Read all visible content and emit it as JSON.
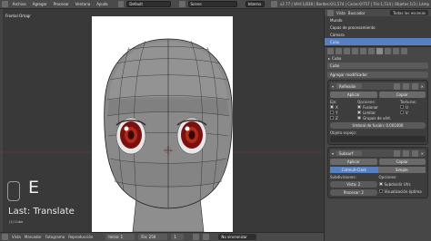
{
  "topbar": {
    "menus": [
      "Archivo",
      "Agregar",
      "Procesar",
      "Ventana",
      "Ayuda"
    ],
    "layout": "Default",
    "scene": "Scene",
    "engine": "Interno",
    "info": "v2.77 | Vért:1/838 | Bordes:0/1,574 | Caras:0/757 | Tris:1,514 | Objetos:1/3 | Lámp"
  },
  "viewport": {
    "view_label": "Frontal Ortogr",
    "last_key": "E",
    "last_operator": "Last: Translate",
    "object_name": "(1) Cubo"
  },
  "statusbar": {
    "items": [
      "Vista",
      "Marcador",
      "Fotograma",
      "Reproducción"
    ],
    "start_field": "Inicio: 1",
    "end_field": "Fin: 250",
    "frame_field": "1",
    "sync": "No sincronizar"
  },
  "outliner": {
    "tabs": [
      "Vista",
      "Buscador"
    ],
    "filter": "Todas las escenas",
    "rows": [
      {
        "label": "Mundo",
        "selected": false
      },
      {
        "label": "Capas de procesamiento",
        "selected": false
      },
      {
        "label": "Cámara",
        "selected": false
      },
      {
        "label": "Cubo",
        "selected": true
      }
    ]
  },
  "properties": {
    "breadcrumb": "Cubo",
    "name_field": "Cubo",
    "add_modifier": "Agregar modificador",
    "mirror": {
      "name": "Reflexión",
      "apply": "Aplicar",
      "copy": "Copiar",
      "axis_header": "Eje:",
      "axes": [
        "X",
        "Y",
        "Z"
      ],
      "options_header": "Opciones:",
      "options": [
        "Fusionar",
        "Limitar",
        "Grupos de vért."
      ],
      "textures_header": "Texturas:",
      "textures": [
        "U",
        "V"
      ],
      "merge_limit": "Umbral de fusión: 0.001000",
      "mirror_object_label": "Objeto espejo:"
    },
    "subsurf": {
      "name": "Subsurf",
      "apply": "Aplicar",
      "copy": "Copiar",
      "mode_active": "Catmull-Clark",
      "mode_other": "Simple",
      "subdivisions_label": "Subdivisiones:",
      "view": "Vista: 2",
      "render": "Procesar: 2",
      "options_label": "Opciones:",
      "uv_subdivide": "Subdividir UVs",
      "optimal_display": "Visualización óptima"
    }
  }
}
